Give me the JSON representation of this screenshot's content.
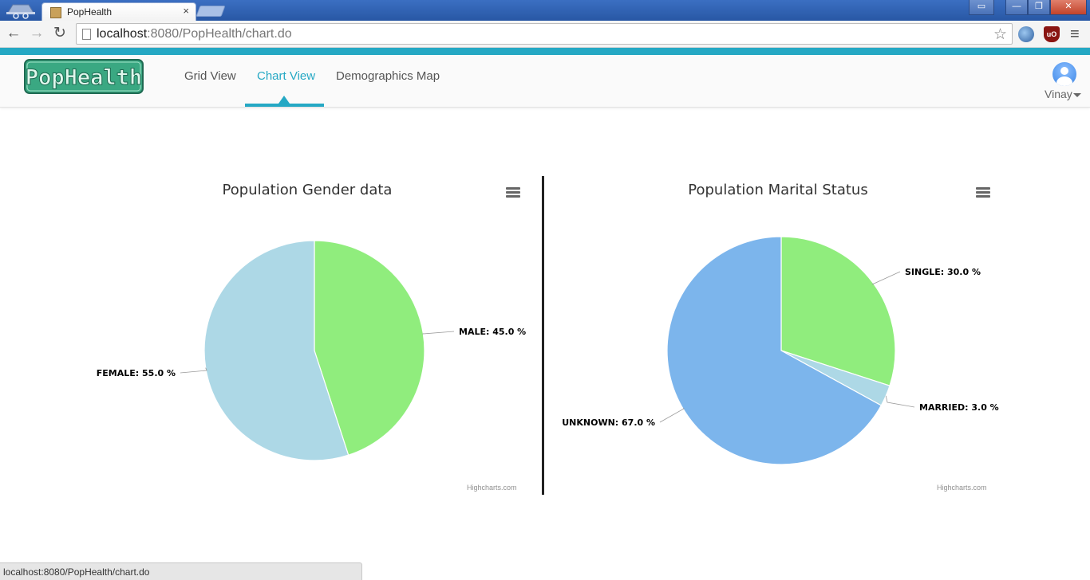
{
  "browser": {
    "tab_title": "PopHealth",
    "tab_close": "×",
    "url_host": "localhost",
    "url_path": ":8080/PopHealth/chart.do",
    "status_url": "localhost:8080/PopHealth/chart.do"
  },
  "app": {
    "logo_text": "PopHealth",
    "nav": [
      {
        "label": "Grid View",
        "active": false
      },
      {
        "label": "Chart View",
        "active": true
      },
      {
        "label": "Demographics Map",
        "active": false
      }
    ],
    "user": {
      "name": "Vinay"
    },
    "accent_color": "#25a8c4"
  },
  "charts": {
    "credits": "Highcharts.com"
  },
  "chart_data": [
    {
      "type": "pie",
      "title": "Population Gender data",
      "series": [
        {
          "name": "MALE",
          "value": 45.0,
          "color": "#90ed7d"
        },
        {
          "name": "FEMALE",
          "value": 55.0,
          "color": "#add8e6"
        }
      ]
    },
    {
      "type": "pie",
      "title": "Population Marital Status",
      "series": [
        {
          "name": "SINGLE",
          "value": 30.0,
          "color": "#90ed7d"
        },
        {
          "name": "MARRIED",
          "value": 3.0,
          "color": "#add8e6"
        },
        {
          "name": "UNKNOWN",
          "value": 67.0,
          "color": "#7cb5ec"
        }
      ]
    }
  ]
}
